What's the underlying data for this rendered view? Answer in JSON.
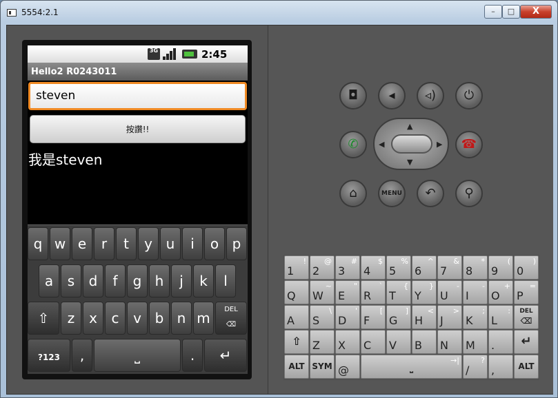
{
  "window": {
    "title": "5554:2.1",
    "min_label": "–",
    "max_label": "□",
    "close_label": "X"
  },
  "status_bar": {
    "network": "3G",
    "time": "2:45 PM"
  },
  "app": {
    "title": "Hello2 R0243011",
    "input_value": "steven",
    "button_label": "按讚!!",
    "result_text": "我是steven"
  },
  "soft_keyboard": {
    "row1": [
      "q",
      "w",
      "e",
      "r",
      "t",
      "y",
      "u",
      "i",
      "o",
      "p"
    ],
    "row2": [
      "a",
      "s",
      "d",
      "f",
      "g",
      "h",
      "j",
      "k",
      "l"
    ],
    "row3": [
      "z",
      "x",
      "c",
      "v",
      "b",
      "n",
      "m"
    ],
    "del_label": "DEL",
    "mode_label": "?123",
    "comma_label": ",",
    "period_label": ".",
    "shift_symbol": "⇧",
    "space_symbol": "⎵",
    "enter_symbol": "↵"
  },
  "hardware_controls": {
    "menu_label": "MENU",
    "icons": [
      "camera-icon",
      "volume-down-icon",
      "volume-up-icon",
      "power-icon",
      "call-icon",
      "dpad",
      "end-call-icon",
      "home-icon",
      "menu-icon",
      "back-icon",
      "search-icon"
    ]
  },
  "hardware_keyboard": {
    "row1": [
      [
        "1",
        "!"
      ],
      [
        "2",
        "@"
      ],
      [
        "3",
        "#"
      ],
      [
        "4",
        "$"
      ],
      [
        "5",
        "%"
      ],
      [
        "6",
        "^"
      ],
      [
        "7",
        "&"
      ],
      [
        "8",
        "*"
      ],
      [
        "9",
        "("
      ],
      [
        "0",
        ")"
      ]
    ],
    "row2": [
      [
        "Q",
        ""
      ],
      [
        "W",
        "~"
      ],
      [
        "E",
        "\""
      ],
      [
        "R",
        "`"
      ],
      [
        "T",
        "{"
      ],
      [
        "Y",
        "}"
      ],
      [
        "U",
        "-"
      ],
      [
        "I",
        "-"
      ],
      [
        "O",
        "+"
      ],
      [
        "P",
        "="
      ]
    ],
    "row3": [
      [
        "A",
        ""
      ],
      [
        "S",
        "\\"
      ],
      [
        "D",
        "'"
      ],
      [
        "F",
        "["
      ],
      [
        "G",
        "]"
      ],
      [
        "H",
        "<"
      ],
      [
        "J",
        ">"
      ],
      [
        "K",
        ";"
      ],
      [
        "L",
        ":"
      ]
    ],
    "row3_del": "DEL",
    "row4": [
      [
        "Z",
        ""
      ],
      [
        "X",
        ""
      ],
      [
        "C",
        ""
      ],
      [
        "V",
        ""
      ],
      [
        "B",
        ""
      ],
      [
        "N",
        ""
      ],
      [
        "M",
        ""
      ],
      [
        ".",
        ""
      ]
    ],
    "row5": {
      "alt": "ALT",
      "sym": "SYM",
      "at": "@",
      "slash": "/",
      "slash_alt": "?",
      "comma": ",",
      "alt_right": "ALT"
    },
    "colors": {
      "key_top": "#cfcfcf",
      "key_bottom": "#a5a5a5"
    }
  }
}
